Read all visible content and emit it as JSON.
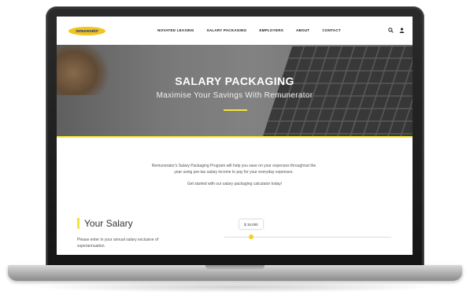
{
  "nav": {
    "logo_text": "remunerator",
    "links": [
      "NOVATED LEASING",
      "SALARY PACKAGING",
      "EMPLOYERS",
      "ABOUT",
      "CONTACT"
    ],
    "search_icon": "search-icon",
    "user_icon": "user-icon"
  },
  "hero": {
    "title": "SALARY PACKAGING",
    "subtitle": "Maximise Your Savings With Remunerator"
  },
  "intro": {
    "line1": "Remunerator's Salary Packaging Program will help you save on your expenses throughout the",
    "line2": "year using pre-tax salary income to pay for your everyday expenses.",
    "cta": "Get started with our salary packaging calculator today!"
  },
  "salary": {
    "heading": "Your Salary",
    "description_line1": "Please enter in your annual salary exclusive of",
    "description_line2": "superannuation.",
    "slider_value": "$ 15,000",
    "slider_fraction": 0.16
  },
  "colors": {
    "accent": "#f5e23a",
    "logo_bg": "#f3c41c",
    "logo_text": "#1b3a8c"
  }
}
